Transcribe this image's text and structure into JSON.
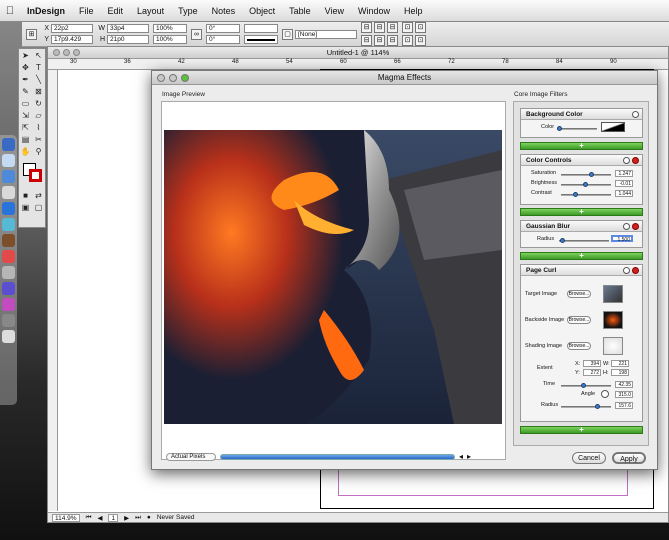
{
  "menubar": {
    "app": "InDesign",
    "items": [
      "File",
      "Edit",
      "Layout",
      "Type",
      "Notes",
      "Object",
      "Table",
      "View",
      "Window",
      "Help"
    ]
  },
  "control": {
    "x": "22p2",
    "y": "17p9.429",
    "w": "33p4",
    "h": "21p0",
    "scale_x": "100%",
    "scale_y": "100%",
    "rotate": "0°",
    "shear": "0°",
    "style": "[None]"
  },
  "doc": {
    "title": "Untitled-1 @ 114%",
    "ruler": [
      "30",
      "36",
      "42",
      "48",
      "54",
      "60",
      "66",
      "72",
      "78",
      "84",
      "90"
    ],
    "zoom": "114.9%",
    "page": "1",
    "status": "Never Saved"
  },
  "dialog": {
    "title": "Magma Effects",
    "preview_label": "Image Preview",
    "filters_label": "Core Image Filters",
    "zoom_option": "Actual Pixels",
    "cancel": "Cancel",
    "apply": "Apply",
    "bg": {
      "title": "Background Color",
      "color_label": "Color"
    },
    "cc": {
      "title": "Color Controls",
      "saturation_label": "Saturation",
      "saturation": "1.247",
      "brightness_label": "Brightness",
      "brightness": "-0.01",
      "contrast_label": "Contrast",
      "contrast": "1.044"
    },
    "gb": {
      "title": "Gaussian Blur",
      "radius_label": "Radius",
      "radius": "1.500"
    },
    "pc": {
      "title": "Page Curl",
      "target_label": "Target Image",
      "backside_label": "Backside Image",
      "shading_label": "Shading Image",
      "browse": "Browse...",
      "extent_label": "Extent",
      "x_label": "X:",
      "x": "394",
      "y_label": "Y:",
      "y": "272",
      "w_label": "W:",
      "w": "221",
      "h_label": "H:",
      "h": "198",
      "time_label": "Time",
      "time": "42.35",
      "angle_label": "Angle",
      "angle": "315.0",
      "radius_label": "Radius",
      "radius": "157.6"
    }
  },
  "colors": {
    "accent": "#3a7ad6",
    "add_bar": "#4caf2f",
    "close_red": "#cc2222"
  }
}
